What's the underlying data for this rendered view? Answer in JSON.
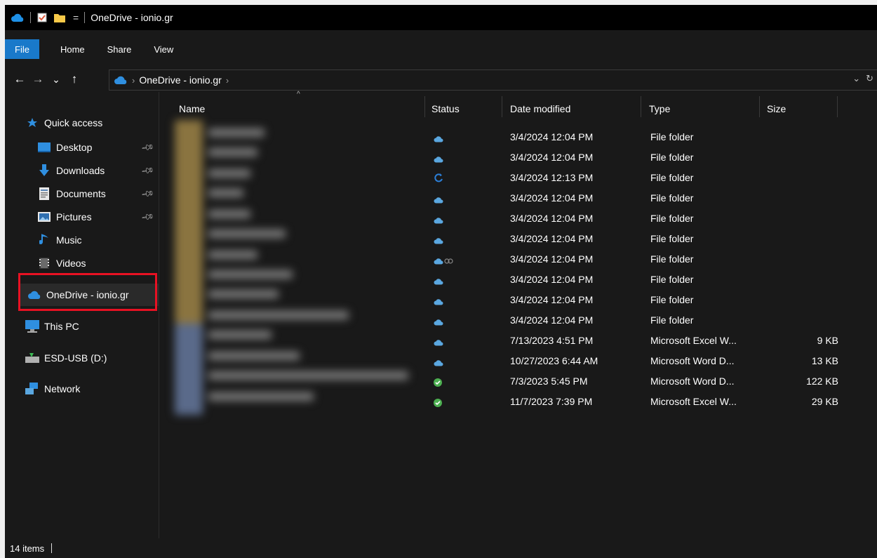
{
  "window": {
    "title": "OneDrive - ionio.gr",
    "dropdown_glyph": "="
  },
  "ribbon": {
    "tabs": [
      {
        "label": "File"
      },
      {
        "label": "Home"
      },
      {
        "label": "Share"
      },
      {
        "label": "View"
      }
    ]
  },
  "navigation": {
    "back": "←",
    "forward": "→",
    "recent": "⌄",
    "up": "↑"
  },
  "address": {
    "crumbs": [
      {
        "label": "OneDrive - ionio.gr"
      }
    ],
    "separator": "›"
  },
  "sidebar": {
    "items": [
      {
        "label": "Quick access",
        "icon": "star-icon",
        "pinned": false
      },
      {
        "label": "Desktop",
        "icon": "desktop-icon",
        "pinned": true
      },
      {
        "label": "Downloads",
        "icon": "download-arrow-icon",
        "pinned": true
      },
      {
        "label": "Documents",
        "icon": "documents-icon",
        "pinned": true
      },
      {
        "label": "Pictures",
        "icon": "pictures-icon",
        "pinned": true
      },
      {
        "label": "Music",
        "icon": "music-note-icon",
        "pinned": false
      },
      {
        "label": "Videos",
        "icon": "videos-icon",
        "pinned": false
      },
      {
        "label": "OneDrive - ionio.gr",
        "icon": "onedrive-cloud-icon",
        "pinned": false,
        "selected": true
      },
      {
        "label": "This PC",
        "icon": "computer-icon",
        "pinned": false
      },
      {
        "label": "ESD-USB (D:)",
        "icon": "usb-drive-icon",
        "pinned": false
      },
      {
        "label": "Network",
        "icon": "network-icon",
        "pinned": false
      }
    ]
  },
  "file_list": {
    "columns": [
      "Name",
      "Status",
      "Date modified",
      "Type",
      "Size"
    ],
    "rows": [
      {
        "status": "cloud",
        "date": "3/4/2024 12:04 PM",
        "type": "File folder",
        "size": ""
      },
      {
        "status": "cloud",
        "date": "3/4/2024 12:04 PM",
        "type": "File folder",
        "size": ""
      },
      {
        "status": "sync",
        "date": "3/4/2024 12:13 PM",
        "type": "File folder",
        "size": ""
      },
      {
        "status": "cloud",
        "date": "3/4/2024 12:04 PM",
        "type": "File folder",
        "size": ""
      },
      {
        "status": "cloud",
        "date": "3/4/2024 12:04 PM",
        "type": "File folder",
        "size": ""
      },
      {
        "status": "cloud",
        "date": "3/4/2024 12:04 PM",
        "type": "File folder",
        "size": ""
      },
      {
        "status": "cloud-shared",
        "date": "3/4/2024 12:04 PM",
        "type": "File folder",
        "size": ""
      },
      {
        "status": "cloud",
        "date": "3/4/2024 12:04 PM",
        "type": "File folder",
        "size": ""
      },
      {
        "status": "cloud",
        "date": "3/4/2024 12:04 PM",
        "type": "File folder",
        "size": ""
      },
      {
        "status": "cloud",
        "date": "3/4/2024 12:04 PM",
        "type": "File folder",
        "size": ""
      },
      {
        "status": "cloud",
        "date": "7/13/2023 4:51 PM",
        "type": "Microsoft Excel W...",
        "size": "9 KB"
      },
      {
        "status": "cloud",
        "date": "10/27/2023 6:44 AM",
        "type": "Microsoft Word D...",
        "size": "13 KB"
      },
      {
        "status": "local",
        "date": "7/3/2023 5:45 PM",
        "type": "Microsoft Word D...",
        "size": "122 KB"
      },
      {
        "status": "local",
        "date": "11/7/2023 7:39 PM",
        "type": "Microsoft Excel W...",
        "size": "29 KB"
      }
    ]
  },
  "status_bar": {
    "item_count": "14 items"
  },
  "colors": {
    "background": "#191919",
    "accent": "#1979ca",
    "cloud_icon": "#5aa7e0",
    "sync_icon": "#2b7fd8",
    "local_check": "#4caf50",
    "highlight": "#e81123"
  }
}
